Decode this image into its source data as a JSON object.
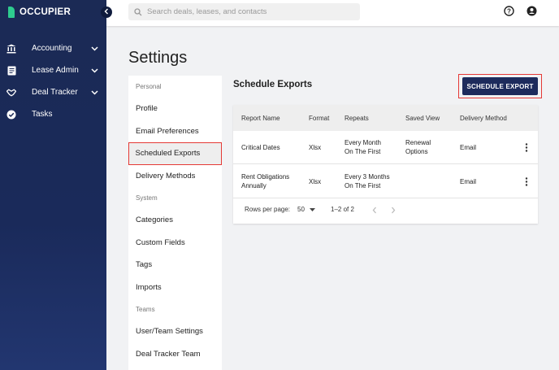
{
  "brand": {
    "name": "OCCUPIER",
    "accent": "#2ecc8f",
    "sidebar_color": "#1b2a55",
    "highlight_color": "#e53935"
  },
  "sidebar": {
    "items": [
      {
        "label": "Accounting",
        "icon": "bank-icon",
        "expandable": true
      },
      {
        "label": "Lease Admin",
        "icon": "document-icon",
        "expandable": true
      },
      {
        "label": "Deal Tracker",
        "icon": "handshake-icon",
        "expandable": true
      },
      {
        "label": "Tasks",
        "icon": "check-circle-icon",
        "expandable": false
      }
    ]
  },
  "topbar": {
    "search_placeholder": "Search deals, leases, and contacts"
  },
  "page": {
    "title": "Settings"
  },
  "settings_nav": {
    "personal_label": "Personal",
    "personal_items": [
      "Profile",
      "Email Preferences",
      "Scheduled Exports",
      "Delivery Methods"
    ],
    "system_label": "System",
    "system_items": [
      "Categories",
      "Custom Fields",
      "Tags",
      "Imports"
    ],
    "teams_label": "Teams",
    "teams_items": [
      "User/Team Settings",
      "Deal Tracker Team"
    ],
    "active": "Scheduled Exports"
  },
  "schedule": {
    "title": "Schedule Exports",
    "button_label": "SCHEDULE EXPORT",
    "columns": [
      "Report Name",
      "Format",
      "Repeats",
      "Saved View",
      "Delivery Method"
    ],
    "rows": [
      {
        "name_1": "Critical Dates",
        "name_2": "",
        "format": "Xlsx",
        "repeats_1": "Every Month",
        "repeats_2": "On The First",
        "view_1": "Renewal",
        "view_2": "Options",
        "delivery": "Email"
      },
      {
        "name_1": "Rent Obligations",
        "name_2": "Annually",
        "format": "Xlsx",
        "repeats_1": "Every 3 Months",
        "repeats_2": "On The First",
        "view_1": "",
        "view_2": "",
        "delivery": "Email"
      }
    ],
    "pagination": {
      "rows_label": "Rows per page:",
      "rows_value": "50",
      "range": "1–2 of 2"
    }
  }
}
